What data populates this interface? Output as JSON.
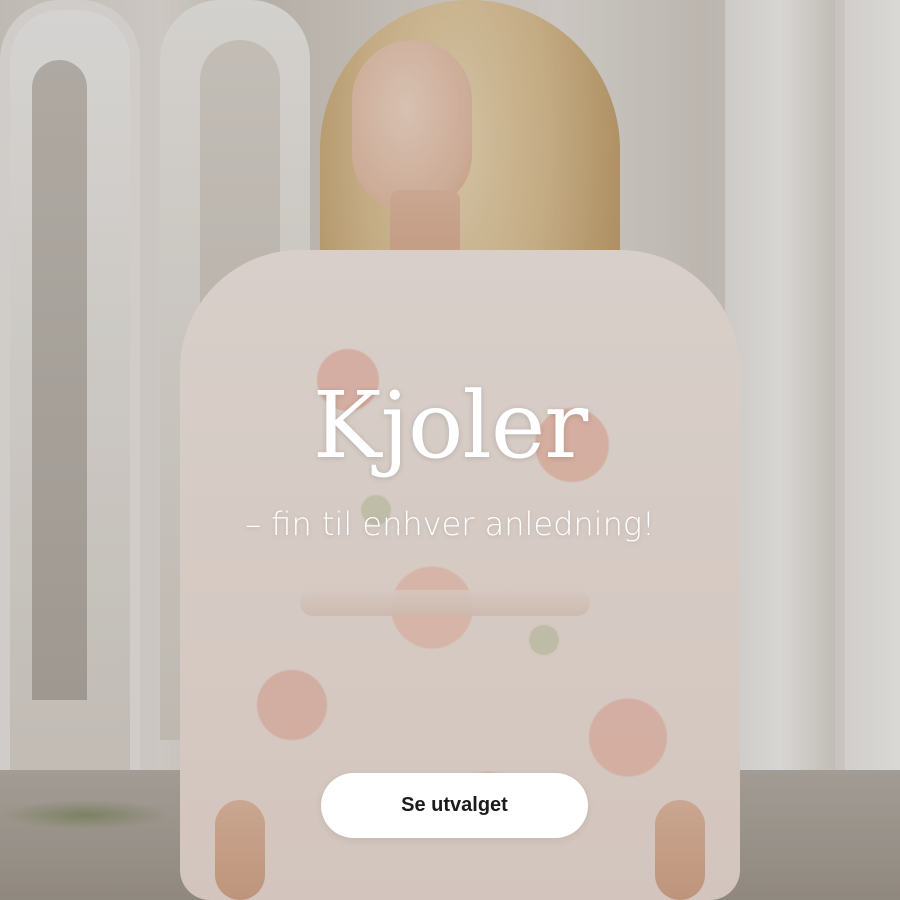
{
  "hero": {
    "title": "Kjoler",
    "subtitle": "– fin til enhver anledning!",
    "cta_label": "Se utvalget"
  },
  "colors": {
    "text": "#ffffff",
    "button_bg": "#ffffff",
    "button_text": "#1b1b1b"
  }
}
